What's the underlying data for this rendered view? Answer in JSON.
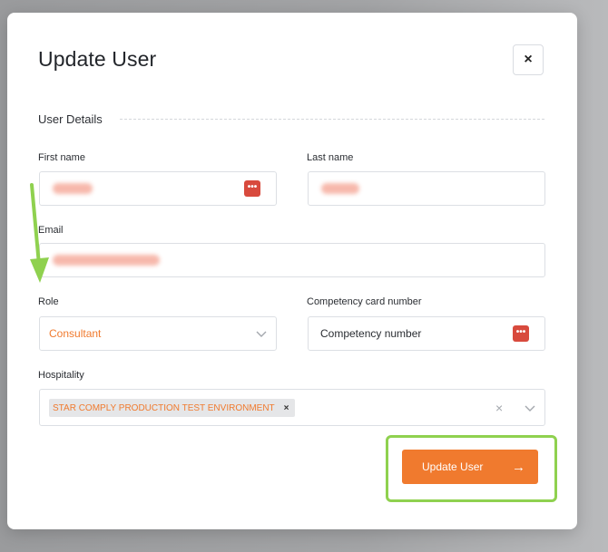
{
  "modal": {
    "title": "Update User",
    "close_label": "×",
    "section_title": "User Details"
  },
  "form": {
    "first_name": {
      "label": "First name"
    },
    "last_name": {
      "label": "Last name"
    },
    "email": {
      "label": "Email"
    },
    "role": {
      "label": "Role",
      "value": "Consultant"
    },
    "competency": {
      "label": "Competency card number",
      "placeholder": "Competency number"
    },
    "hospitality": {
      "label": "Hospitality",
      "tag": "STAR COMPLY PRODUCTION TEST ENVIRONMENT",
      "tag_remove": "×",
      "clear": "×"
    }
  },
  "actions": {
    "update_label": "Update User",
    "update_arrow": "→"
  },
  "colors": {
    "accent": "#f07a2e",
    "highlight": "#8fd14f",
    "password_icon": "#d84a3d"
  },
  "icons": {
    "password": "password-dots-icon",
    "chevron": "chevron-down-icon",
    "close": "close-icon",
    "arrow": "arrow-right-icon"
  }
}
